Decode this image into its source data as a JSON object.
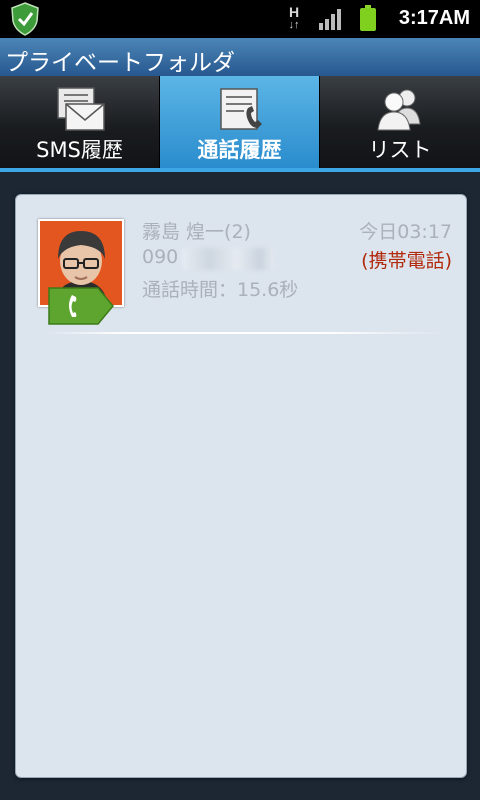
{
  "status_bar": {
    "network": "H",
    "time": "3:17AM",
    "icons": [
      "shield-app-icon",
      "network-h-icon",
      "signal-icon",
      "battery-icon"
    ]
  },
  "app": {
    "title": "プライベートフォルダ"
  },
  "tabs": [
    {
      "label": "SMS履歴",
      "icon": "sms-envelope-icon",
      "active": false
    },
    {
      "label": "通話履歴",
      "icon": "call-log-icon",
      "active": true
    },
    {
      "label": "リスト",
      "icon": "contacts-list-icon",
      "active": false
    }
  ],
  "call_log": [
    {
      "name": "霧島 煌一(2)",
      "time": "今日03:17",
      "number": "090",
      "type": "(携帯電話)",
      "duration": "通話時間：15.6秒"
    }
  ],
  "colors": {
    "title_bar": "#3a6ea3",
    "tab_active": "#3fa0db",
    "panel_bg": "#dce4ee",
    "call_type": "#b22a0c",
    "call_tag": "#5ea52f"
  }
}
